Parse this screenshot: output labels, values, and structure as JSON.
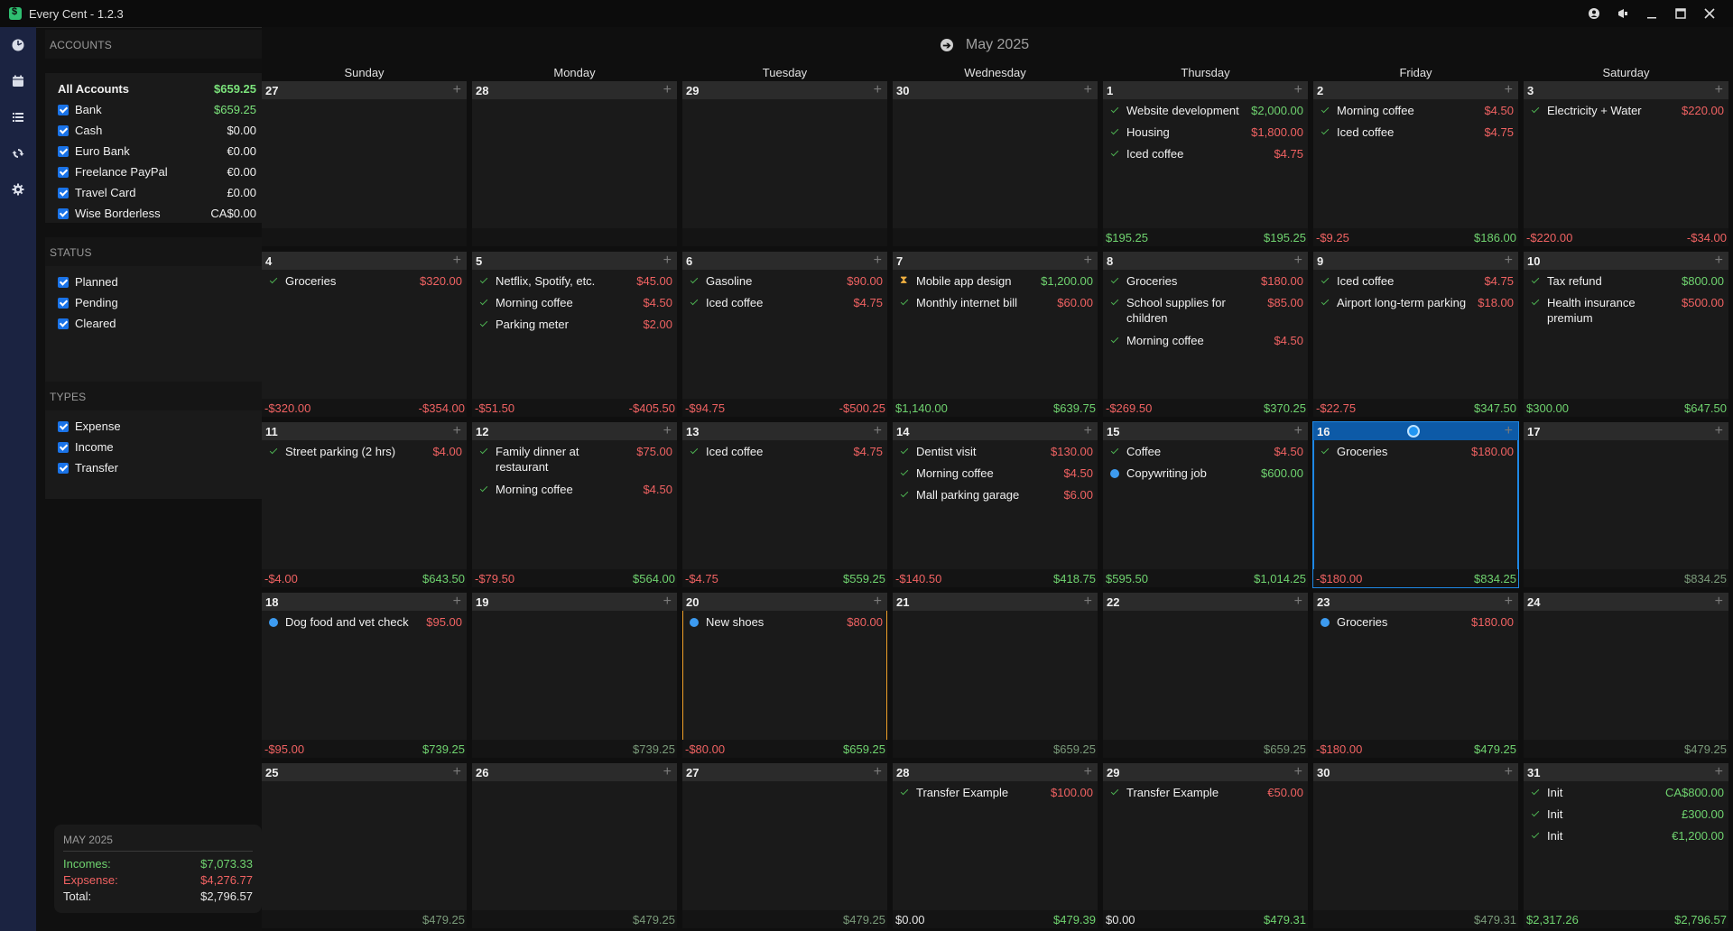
{
  "app": {
    "title": "Every Cent - 1.2.3",
    "titlebar_buttons": [
      "profile-icon",
      "megaphone-icon",
      "minimize-icon",
      "maximize-icon",
      "close-icon"
    ]
  },
  "leftnav": {
    "items": [
      "dashboard-icon",
      "calendar-icon",
      "list-icon",
      "sync-icon",
      "settings-icon"
    ]
  },
  "sidebar": {
    "accounts_heading": "ACCOUNTS",
    "all_accounts": {
      "label": "All Accounts",
      "value": "$659.25"
    },
    "accounts": [
      {
        "label": "Bank",
        "value": "$659.25"
      },
      {
        "label": "Cash",
        "value": "$0.00"
      },
      {
        "label": "Euro Bank",
        "value": "€0.00"
      },
      {
        "label": "Freelance PayPal",
        "value": "€0.00"
      },
      {
        "label": "Travel Card",
        "value": "£0.00"
      },
      {
        "label": "Wise Borderless",
        "value": "CA$0.00"
      }
    ],
    "status_heading": "STATUS",
    "status": [
      "Planned",
      "Pending",
      "Cleared"
    ],
    "types_heading": "TYPES",
    "types": [
      "Expense",
      "Income",
      "Transfer"
    ]
  },
  "summary": {
    "heading": "MAY 2025",
    "incomes_label": "Incomes:",
    "incomes": "$7,073.33",
    "expense_label": "Expsense:",
    "expense": "$4,276.77",
    "total_label": "Total:",
    "total": "$2,796.57"
  },
  "calendar": {
    "month": "May 2025",
    "weekdays": [
      "Sunday",
      "Monday",
      "Tuesday",
      "Wednesday",
      "Thursday",
      "Friday",
      "Saturday"
    ],
    "weeks": [
      [
        {
          "day": "27",
          "tx": [],
          "left": "",
          "right": ""
        },
        {
          "day": "28",
          "tx": [],
          "left": "",
          "right": ""
        },
        {
          "day": "29",
          "tx": [],
          "left": "",
          "right": ""
        },
        {
          "day": "30",
          "tx": [],
          "left": "",
          "right": ""
        },
        {
          "day": "1",
          "tx": [
            {
              "s": "cleared",
              "name": "Website development",
              "amt": "$2,000.00",
              "type": "income"
            },
            {
              "s": "cleared",
              "name": "Housing",
              "amt": "$1,800.00",
              "type": "expense"
            },
            {
              "s": "cleared",
              "name": "Iced coffee",
              "amt": "$4.75",
              "type": "expense"
            }
          ],
          "left": "$195.25",
          "leftType": "pos",
          "right": "$195.25",
          "rightType": "pos"
        },
        {
          "day": "2",
          "tx": [
            {
              "s": "cleared",
              "name": "Morning coffee",
              "amt": "$4.50",
              "type": "expense"
            },
            {
              "s": "cleared",
              "name": "Iced coffee",
              "amt": "$4.75",
              "type": "expense"
            }
          ],
          "left": "-$9.25",
          "leftType": "neg",
          "right": "$186.00",
          "rightType": "pos"
        },
        {
          "day": "3",
          "tx": [
            {
              "s": "cleared",
              "name": "Electricity + Water",
              "amt": "$220.00",
              "type": "expense"
            }
          ],
          "left": "-$220.00",
          "leftType": "neg",
          "right": "-$34.00",
          "rightType": "neg"
        }
      ],
      [
        {
          "day": "4",
          "tx": [
            {
              "s": "cleared",
              "name": "Groceries",
              "amt": "$320.00",
              "type": "expense"
            }
          ],
          "left": "-$320.00",
          "leftType": "neg",
          "right": "-$354.00",
          "rightType": "neg"
        },
        {
          "day": "5",
          "tx": [
            {
              "s": "cleared",
              "name": "Netflix, Spotify, etc.",
              "amt": "$45.00",
              "type": "expense"
            },
            {
              "s": "cleared",
              "name": "Morning coffee",
              "amt": "$4.50",
              "type": "expense"
            },
            {
              "s": "cleared",
              "name": "Parking meter",
              "amt": "$2.00",
              "type": "expense"
            }
          ],
          "left": "-$51.50",
          "leftType": "neg",
          "right": "-$405.50",
          "rightType": "neg"
        },
        {
          "day": "6",
          "tx": [
            {
              "s": "cleared",
              "name": "Gasoline",
              "amt": "$90.00",
              "type": "expense"
            },
            {
              "s": "cleared",
              "name": "Iced coffee",
              "amt": "$4.75",
              "type": "expense"
            }
          ],
          "left": "-$94.75",
          "leftType": "neg",
          "right": "-$500.25",
          "rightType": "neg"
        },
        {
          "day": "7",
          "tx": [
            {
              "s": "pending",
              "name": "Mobile app design",
              "amt": "$1,200.00",
              "type": "income"
            },
            {
              "s": "cleared",
              "name": "Monthly internet bill",
              "amt": "$60.00",
              "type": "expense"
            }
          ],
          "left": "$1,140.00",
          "leftType": "pos",
          "right": "$639.75",
          "rightType": "pos"
        },
        {
          "day": "8",
          "tx": [
            {
              "s": "cleared",
              "name": "Groceries",
              "amt": "$180.00",
              "type": "expense"
            },
            {
              "s": "cleared",
              "name": "School supplies for children",
              "amt": "$85.00",
              "type": "expense"
            },
            {
              "s": "cleared",
              "name": "Morning coffee",
              "amt": "$4.50",
              "type": "expense"
            }
          ],
          "left": "-$269.50",
          "leftType": "neg",
          "right": "$370.25",
          "rightType": "pos"
        },
        {
          "day": "9",
          "tx": [
            {
              "s": "cleared",
              "name": "Iced coffee",
              "amt": "$4.75",
              "type": "expense"
            },
            {
              "s": "cleared",
              "name": "Airport long-term parking",
              "amt": "$18.00",
              "type": "expense"
            }
          ],
          "left": "-$22.75",
          "leftType": "neg",
          "right": "$347.50",
          "rightType": "pos"
        },
        {
          "day": "10",
          "tx": [
            {
              "s": "cleared",
              "name": "Tax refund",
              "amt": "$800.00",
              "type": "income"
            },
            {
              "s": "cleared",
              "name": "Health insurance premium",
              "amt": "$500.00",
              "type": "expense"
            }
          ],
          "left": "$300.00",
          "leftType": "pos",
          "right": "$647.50",
          "rightType": "pos"
        }
      ],
      [
        {
          "day": "11",
          "tx": [
            {
              "s": "cleared",
              "name": "Street parking (2 hrs)",
              "amt": "$4.00",
              "type": "expense"
            }
          ],
          "left": "-$4.00",
          "leftType": "neg",
          "right": "$643.50",
          "rightType": "pos"
        },
        {
          "day": "12",
          "tx": [
            {
              "s": "cleared",
              "name": "Family dinner at restaurant",
              "amt": "$75.00",
              "type": "expense"
            },
            {
              "s": "cleared",
              "name": "Morning coffee",
              "amt": "$4.50",
              "type": "expense"
            }
          ],
          "left": "-$79.50",
          "leftType": "neg",
          "right": "$564.00",
          "rightType": "pos"
        },
        {
          "day": "13",
          "tx": [
            {
              "s": "cleared",
              "name": "Iced coffee",
              "amt": "$4.75",
              "type": "expense"
            }
          ],
          "left": "-$4.75",
          "leftType": "neg",
          "right": "$559.25",
          "rightType": "pos"
        },
        {
          "day": "14",
          "tx": [
            {
              "s": "cleared",
              "name": "Dentist visit",
              "amt": "$130.00",
              "type": "expense"
            },
            {
              "s": "cleared",
              "name": "Morning coffee",
              "amt": "$4.50",
              "type": "expense"
            },
            {
              "s": "cleared",
              "name": "Mall parking garage",
              "amt": "$6.00",
              "type": "expense"
            }
          ],
          "left": "-$140.50",
          "leftType": "neg",
          "right": "$418.75",
          "rightType": "pos"
        },
        {
          "day": "15",
          "tx": [
            {
              "s": "cleared",
              "name": "Coffee",
              "amt": "$4.50",
              "type": "expense"
            },
            {
              "s": "planned",
              "name": "Copywriting job",
              "amt": "$600.00",
              "type": "income"
            }
          ],
          "left": "$595.50",
          "leftType": "pos",
          "right": "$1,014.25",
          "rightType": "pos"
        },
        {
          "day": "16",
          "selected": true,
          "tx": [
            {
              "s": "cleared",
              "name": "Groceries",
              "amt": "$180.00",
              "type": "expense"
            }
          ],
          "left": "-$180.00",
          "leftType": "neg",
          "right": "$834.25",
          "rightType": "pos"
        },
        {
          "day": "17",
          "tx": [],
          "left": "",
          "right": "$834.25",
          "rightType": "mute"
        }
      ],
      [
        {
          "day": "18",
          "tx": [
            {
              "s": "planned",
              "name": "Dog food and vet check",
              "amt": "$95.00",
              "type": "expense"
            }
          ],
          "left": "-$95.00",
          "leftType": "neg",
          "right": "$739.25",
          "rightType": "pos"
        },
        {
          "day": "19",
          "tx": [],
          "left": "",
          "right": "$739.25",
          "rightType": "mute"
        },
        {
          "day": "20",
          "today": true,
          "tx": [
            {
              "s": "planned",
              "name": "New shoes",
              "amt": "$80.00",
              "type": "expense"
            }
          ],
          "left": "-$80.00",
          "leftType": "neg",
          "right": "$659.25",
          "rightType": "pos"
        },
        {
          "day": "21",
          "tx": [],
          "left": "",
          "right": "$659.25",
          "rightType": "mute"
        },
        {
          "day": "22",
          "tx": [],
          "left": "",
          "right": "$659.25",
          "rightType": "mute"
        },
        {
          "day": "23",
          "tx": [
            {
              "s": "planned",
              "name": "Groceries",
              "amt": "$180.00",
              "type": "expense"
            }
          ],
          "left": "-$180.00",
          "leftType": "neg",
          "right": "$479.25",
          "rightType": "pos"
        },
        {
          "day": "24",
          "tx": [],
          "left": "",
          "right": "$479.25",
          "rightType": "mute"
        }
      ],
      [
        {
          "day": "25",
          "tx": [],
          "left": "",
          "right": "$479.25",
          "rightType": "mute"
        },
        {
          "day": "26",
          "tx": [],
          "left": "",
          "right": "$479.25",
          "rightType": "mute"
        },
        {
          "day": "27",
          "tx": [],
          "left": "",
          "right": "$479.25",
          "rightType": "mute"
        },
        {
          "day": "28",
          "tx": [
            {
              "s": "cleared",
              "name": "Transfer Example",
              "amt": "$100.00",
              "type": "expense"
            }
          ],
          "left": "$0.00",
          "leftType": "white",
          "right": "$479.39",
          "rightType": "pos"
        },
        {
          "day": "29",
          "tx": [
            {
              "s": "cleared",
              "name": "Transfer Example",
              "amt": "€50.00",
              "type": "expense"
            }
          ],
          "left": "$0.00",
          "leftType": "white",
          "right": "$479.31",
          "rightType": "pos"
        },
        {
          "day": "30",
          "tx": [],
          "left": "",
          "right": "$479.31",
          "rightType": "mute"
        },
        {
          "day": "31",
          "tx": [
            {
              "s": "cleared",
              "name": "Init",
              "amt": "CA$800.00",
              "type": "income"
            },
            {
              "s": "cleared",
              "name": "Init",
              "amt": "£300.00",
              "type": "income"
            },
            {
              "s": "cleared",
              "name": "Init",
              "amt": "€1,200.00",
              "type": "income"
            }
          ],
          "left": "$2,317.26",
          "leftType": "pos",
          "right": "$2,796.57",
          "rightType": "pos"
        }
      ]
    ]
  },
  "colors": {
    "accent": "#1e88e5",
    "income": "#6fd36f",
    "expense": "#f06262",
    "today_border": "#f0a028",
    "nav_bg": "#1b2341"
  }
}
